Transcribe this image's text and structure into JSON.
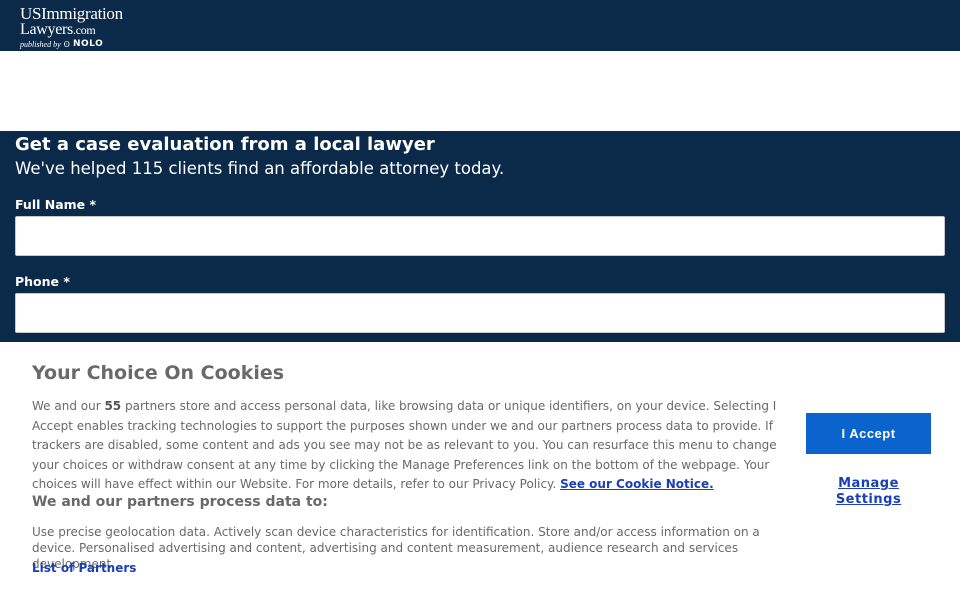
{
  "header": {
    "logo": {
      "line1": "USImmigration",
      "line2_main": "Lawyers",
      "line2_suffix": ".com",
      "published_by": "published by",
      "nolo_mark": "Ꙩ",
      "nolo": "NOLO"
    }
  },
  "form": {
    "title": "Get a case evaluation from a local lawyer",
    "subtitle": "We've helped 115 clients find an affordable attorney today.",
    "full_name_label": "Full Name *",
    "full_name_value": "",
    "phone_label": "Phone *",
    "phone_value": ""
  },
  "cookie_banner": {
    "title": "Your Choice On Cookies",
    "body_prefix": "We and our ",
    "partner_count": "55",
    "body_main": " partners store and access personal data, like browsing data or unique identifiers, on your device. Selecting I Accept enables tracking technologies to support the purposes shown under we and our partners process data to provide. If trackers are disabled, some content and ads you see may not be as relevant to you. You can resurface this menu to change your choices or withdraw consent at any time by clicking the Manage Preferences link on the bottom of the webpage. Your choices will have effect within our Website. For more details, refer to our Privacy Policy. ",
    "cookie_notice_link": "See our Cookie Notice.",
    "subheading": "We and our partners process data to:",
    "purposes": "Use precise geolocation data. Actively scan device characteristics for identification. Store and/or access information on a device. Personalised advertising and content, advertising and content measurement, audience research and services development.",
    "partners_link": "List of Partners",
    "accept_label": "I Accept",
    "manage_label": "Manage Settings"
  },
  "colors": {
    "brand_navy": "#0b2a4a",
    "accept_blue": "#0b63ce",
    "link_blue": "#1a3fb8"
  }
}
